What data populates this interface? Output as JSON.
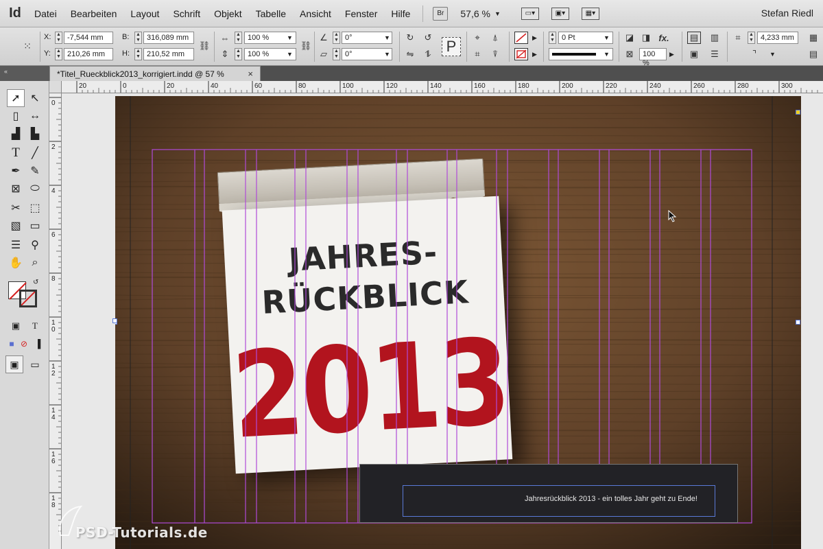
{
  "app": {
    "logo": "Id",
    "user": "Stefan Riedl",
    "bridge_label": "Br",
    "zoom": "57,6 %"
  },
  "menu": [
    "Datei",
    "Bearbeiten",
    "Layout",
    "Schrift",
    "Objekt",
    "Tabelle",
    "Ansicht",
    "Fenster",
    "Hilfe"
  ],
  "control": {
    "x_label": "X:",
    "x_value": "-7,544 mm",
    "y_label": "Y:",
    "y_value": "210,26 mm",
    "w_label": "B:",
    "w_value": "316,089 mm",
    "h_label": "H:",
    "h_value": "210,52 mm",
    "scale_x": "100 %",
    "scale_y": "100 %",
    "rotate": "0°",
    "shear": "0°",
    "stroke_weight": "0 Pt",
    "opacity": "100 %",
    "spacing": "4,233 mm"
  },
  "document": {
    "tab_title": "*Titel_Rueckblick2013_korrigiert.indd @ 57 %",
    "close": "×"
  },
  "ruler": {
    "top_ticks": [
      "20",
      "0",
      "20",
      "40",
      "60",
      "80",
      "100",
      "120",
      "140",
      "160",
      "180",
      "200",
      "220",
      "240",
      "260",
      "280",
      "300"
    ],
    "left_ticks": [
      "0",
      "2",
      "4",
      "6",
      "8",
      "1 0",
      "1 2",
      "1 4",
      "1 6",
      "1 8"
    ]
  },
  "artwork": {
    "line1": "JAHRES-",
    "line2": "RÜCKBLICK",
    "year": "2013",
    "caption": "Jahresrückblick 2013 - ein tolles Jahr geht zu Ende!"
  },
  "watermark": "PSD-Tutorials.de",
  "colors": {
    "guide": "#b04ad8",
    "frame_blue": "#5a7ad8",
    "year_red": "#b2141e",
    "wood": "#6b4a2e"
  },
  "tools": [
    "selection-tool",
    "direct-selection-tool",
    "page-tool",
    "gap-tool",
    "content-collector-tool",
    "content-placer-tool",
    "type-tool",
    "line-tool",
    "pen-tool",
    "pencil-tool",
    "rectangle-frame-tool",
    "ellipse-tool",
    "scissors-tool",
    "free-transform-tool",
    "gradient-swatch-tool",
    "gradient-feather-tool",
    "note-tool",
    "eyedropper-tool",
    "hand-tool",
    "zoom-tool"
  ]
}
